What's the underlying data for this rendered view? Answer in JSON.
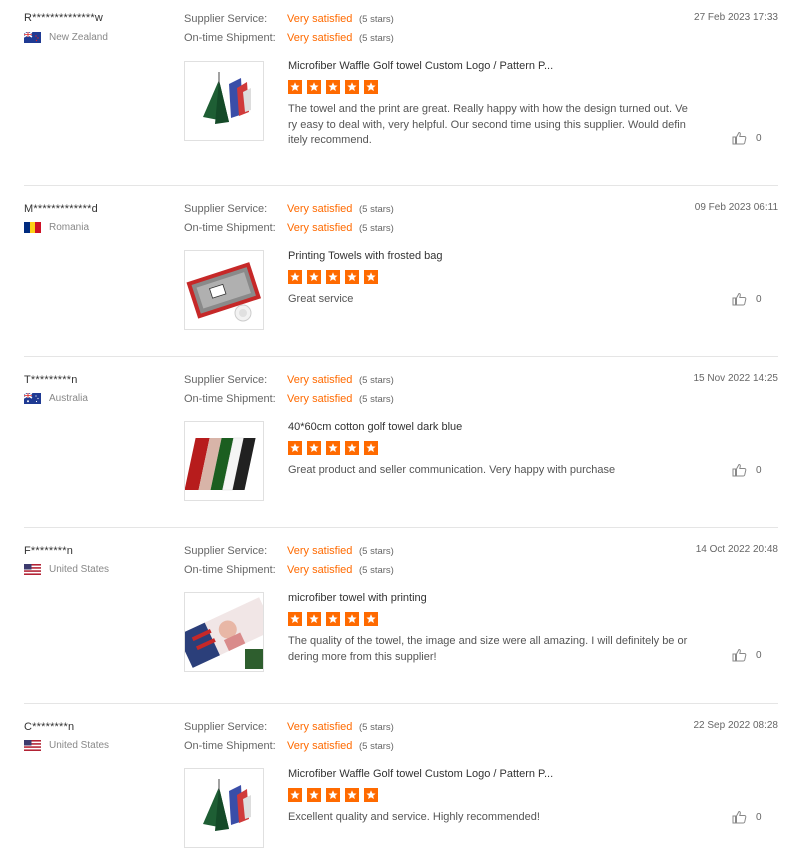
{
  "colors": {
    "accent": "#ff6a00",
    "divider": "#e5e5e5"
  },
  "labels": {
    "supplier_service": "Supplier Service:",
    "on_time_shipment": "On-time Shipment:"
  },
  "reviews": [
    {
      "buyer": "R**************w",
      "country": "New Zealand",
      "flag_icon": "flag-new-zealand-icon",
      "supplier_rating": "Very satisfied",
      "supplier_stars": "(5 stars)",
      "shipment_rating": "Very satisfied",
      "shipment_stars": "(5 stars)",
      "date": "27 Feb 2023 17:33",
      "product": "Microfiber Waffle Golf towel Custom Logo / Pattern P...",
      "rating": 5,
      "comment": "The towel and the print are great. Really happy with how the design turned out. Very easy to deal with, very helpful. Our second time using this supplier. Would definitely recommend.",
      "likes": "0"
    },
    {
      "buyer": "M*************d",
      "country": "Romania",
      "flag_icon": "flag-romania-icon",
      "supplier_rating": "Very satisfied",
      "supplier_stars": "(5 stars)",
      "shipment_rating": "Very satisfied",
      "shipment_stars": "(5 stars)",
      "date": "09 Feb 2023 06:11",
      "product": "Printing Towels with frosted bag",
      "rating": 5,
      "comment": "Great service",
      "likes": "0"
    },
    {
      "buyer": "T*********n",
      "country": "Australia",
      "flag_icon": "flag-australia-icon",
      "supplier_rating": "Very satisfied",
      "supplier_stars": "(5 stars)",
      "shipment_rating": "Very satisfied",
      "shipment_stars": "(5 stars)",
      "date": "15 Nov 2022 14:25",
      "product": "40*60cm cotton golf towel dark blue",
      "rating": 5,
      "comment": "Great product and seller communication.  Very happy with purchase",
      "likes": "0"
    },
    {
      "buyer": "F********n",
      "country": "United States",
      "flag_icon": "flag-united-states-icon",
      "supplier_rating": "Very satisfied",
      "supplier_stars": "(5 stars)",
      "shipment_rating": "Very satisfied",
      "shipment_stars": "(5 stars)",
      "date": "14 Oct 2022 20:48",
      "product": "microfiber towel with printing",
      "rating": 5,
      "comment": "The quality of the towel, the image and size were all amazing. I will definitely be ordering more from this supplier!",
      "likes": "0"
    },
    {
      "buyer": "C********n",
      "country": "United States",
      "flag_icon": "flag-united-states-icon",
      "supplier_rating": "Very satisfied",
      "supplier_stars": "(5 stars)",
      "shipment_rating": "Very satisfied",
      "shipment_stars": "(5 stars)",
      "date": "22 Sep 2022 08:28",
      "product": "Microfiber Waffle Golf towel Custom Logo / Pattern P...",
      "rating": 5,
      "comment": "Excellent quality and service. Highly recommended!",
      "likes": "0"
    }
  ]
}
